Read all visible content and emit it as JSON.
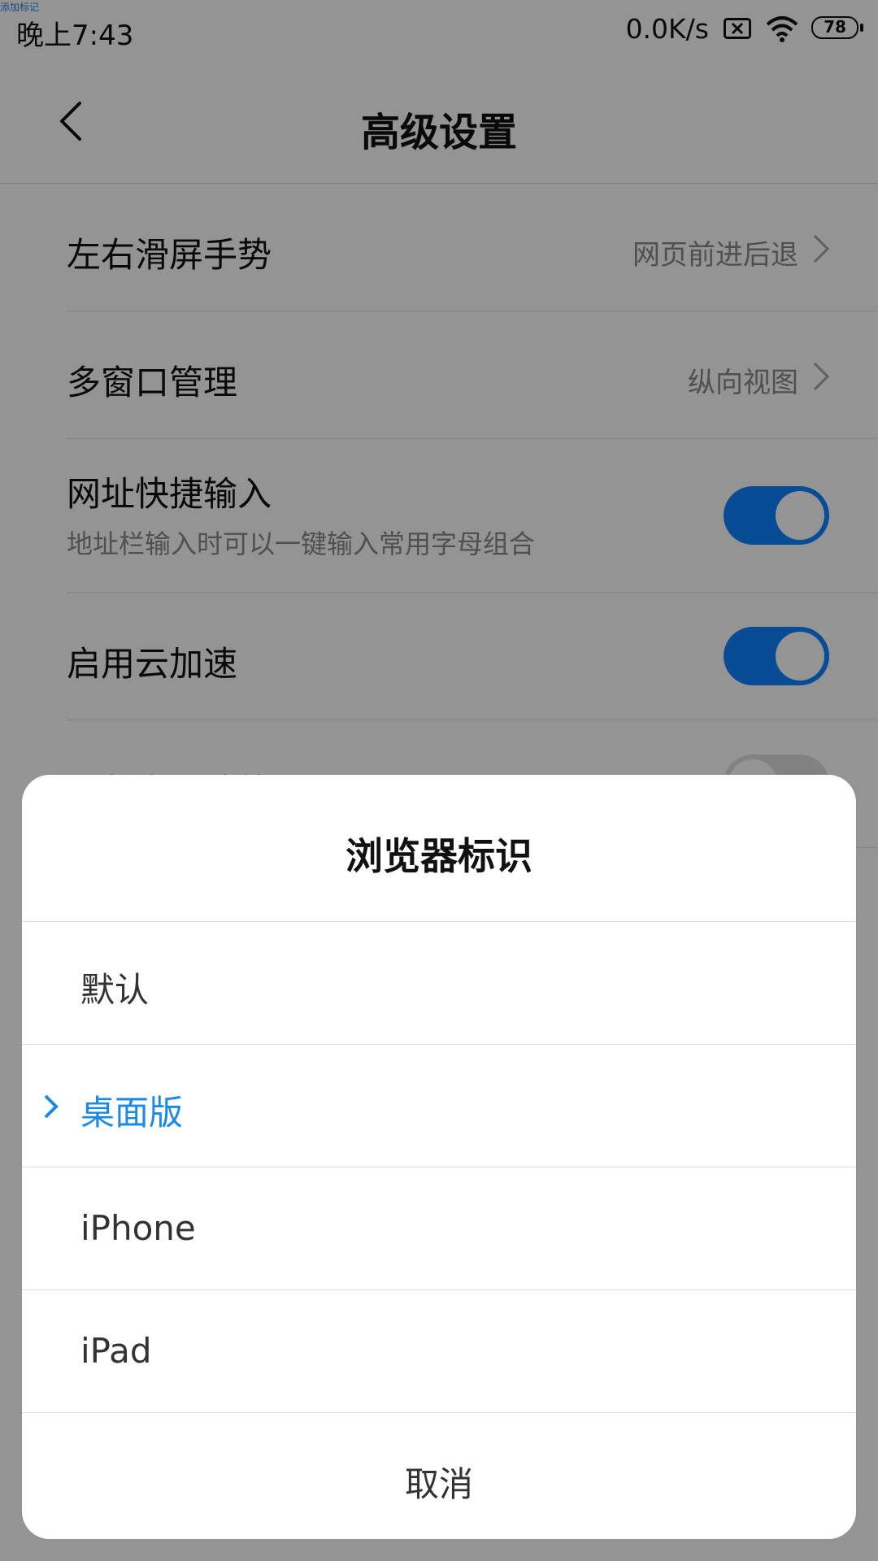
{
  "status_bar": {
    "top_left_label": "添加标记",
    "time": "晚上7:43",
    "net_speed": "0.0K/s",
    "battery": "78",
    "icons": [
      "sim-x-icon",
      "wifi-icon",
      "battery-icon"
    ]
  },
  "header": {
    "title": "高级设置",
    "back_icon": "chevron-left-icon"
  },
  "settings": {
    "items": [
      {
        "title": "左右滑屏手势",
        "value": "网页前进后退"
      },
      {
        "title": "多窗口管理",
        "value": "纵向视图"
      },
      {
        "title": "网址快捷输入",
        "subtitle": "地址栏输入时可以一键输入常用字母组合",
        "toggle": true
      },
      {
        "title": "启用云加速",
        "toggle": true
      },
      {
        "title": "强制启用缩放",
        "toggle": false
      }
    ]
  },
  "dialog": {
    "title": "浏览器标识",
    "options": [
      {
        "label": "默认",
        "selected": false
      },
      {
        "label": "桌面版",
        "selected": true
      },
      {
        "label": "iPhone",
        "selected": false
      },
      {
        "label": "iPad",
        "selected": false
      }
    ],
    "cancel_label": "取消"
  },
  "colors": {
    "accent": "#1b8ae6",
    "toggle_on": "#0d84ff",
    "overlay": "rgba(0,0,0,0.42)"
  }
}
